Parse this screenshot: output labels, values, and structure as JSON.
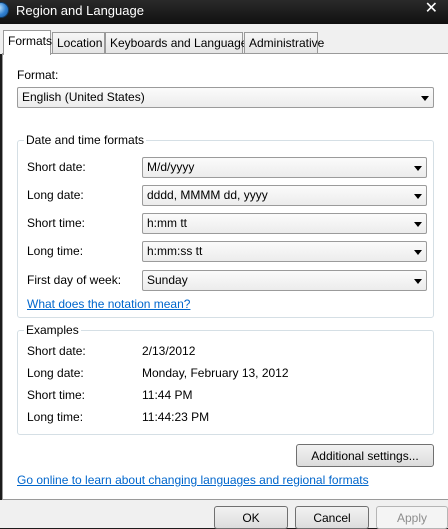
{
  "window": {
    "title": "Region and Language",
    "close_glyph": "✕",
    "icon": "globe-icon"
  },
  "tabs": [
    {
      "label": "Formats",
      "active": true
    },
    {
      "label": "Location",
      "active": false
    },
    {
      "label": "Keyboards and Languages",
      "active": false
    },
    {
      "label": "Administrative",
      "active": false
    }
  ],
  "format": {
    "label": "Format:",
    "value": "English (United States)"
  },
  "date_time": {
    "title": "Date and time formats",
    "short_date": {
      "label": "Short date:",
      "value": "M/d/yyyy"
    },
    "long_date": {
      "label": "Long date:",
      "value": "dddd, MMMM dd, yyyy"
    },
    "short_time": {
      "label": "Short time:",
      "value": "h:mm tt"
    },
    "long_time": {
      "label": "Long time:",
      "value": "h:mm:ss tt"
    },
    "first_day": {
      "label": "First day of week:",
      "value": "Sunday"
    },
    "notation_link": "What does the notation mean?"
  },
  "examples": {
    "title": "Examples",
    "short_date": {
      "label": "Short date:",
      "value": "2/13/2012"
    },
    "long_date": {
      "label": "Long date:",
      "value": "Monday, February 13, 2012"
    },
    "short_time": {
      "label": "Short time:",
      "value": "11:44 PM"
    },
    "long_time": {
      "label": "Long time:",
      "value": "11:44:23 PM"
    }
  },
  "additional_settings_label": "Additional settings...",
  "online_link": "Go online to learn about changing languages and regional formats",
  "footer": {
    "ok": "OK",
    "cancel": "Cancel",
    "apply": "Apply"
  }
}
